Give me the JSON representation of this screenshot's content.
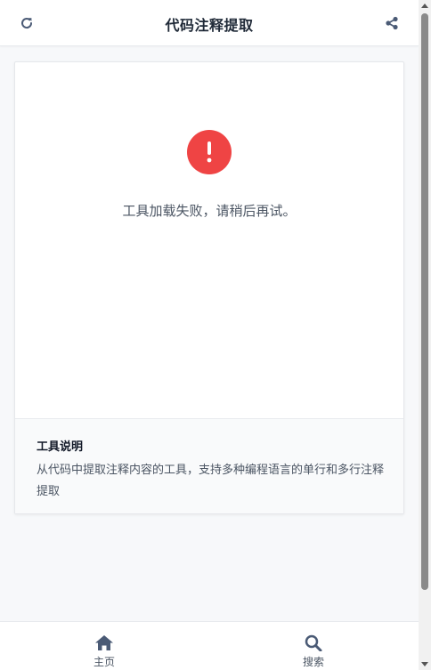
{
  "header": {
    "title": "代码注释提取",
    "refresh_icon": "refresh-icon",
    "share_icon": "share-icon"
  },
  "error": {
    "icon": "exclamation-circle-icon",
    "color": "#ef4444",
    "message": "工具加载失败，请稍后再试。"
  },
  "description": {
    "title": "工具说明",
    "text": "从代码中提取注释内容的工具，支持多种编程语言的单行和多行注释提取"
  },
  "bottom_nav": {
    "items": [
      {
        "label": "主页",
        "icon": "home-icon"
      },
      {
        "label": "搜索",
        "icon": "search-icon"
      }
    ]
  },
  "colors": {
    "text_primary": "#1f2937",
    "text_secondary": "#4b5563",
    "icon": "#4a5a75",
    "background": "#f7f8fa"
  }
}
